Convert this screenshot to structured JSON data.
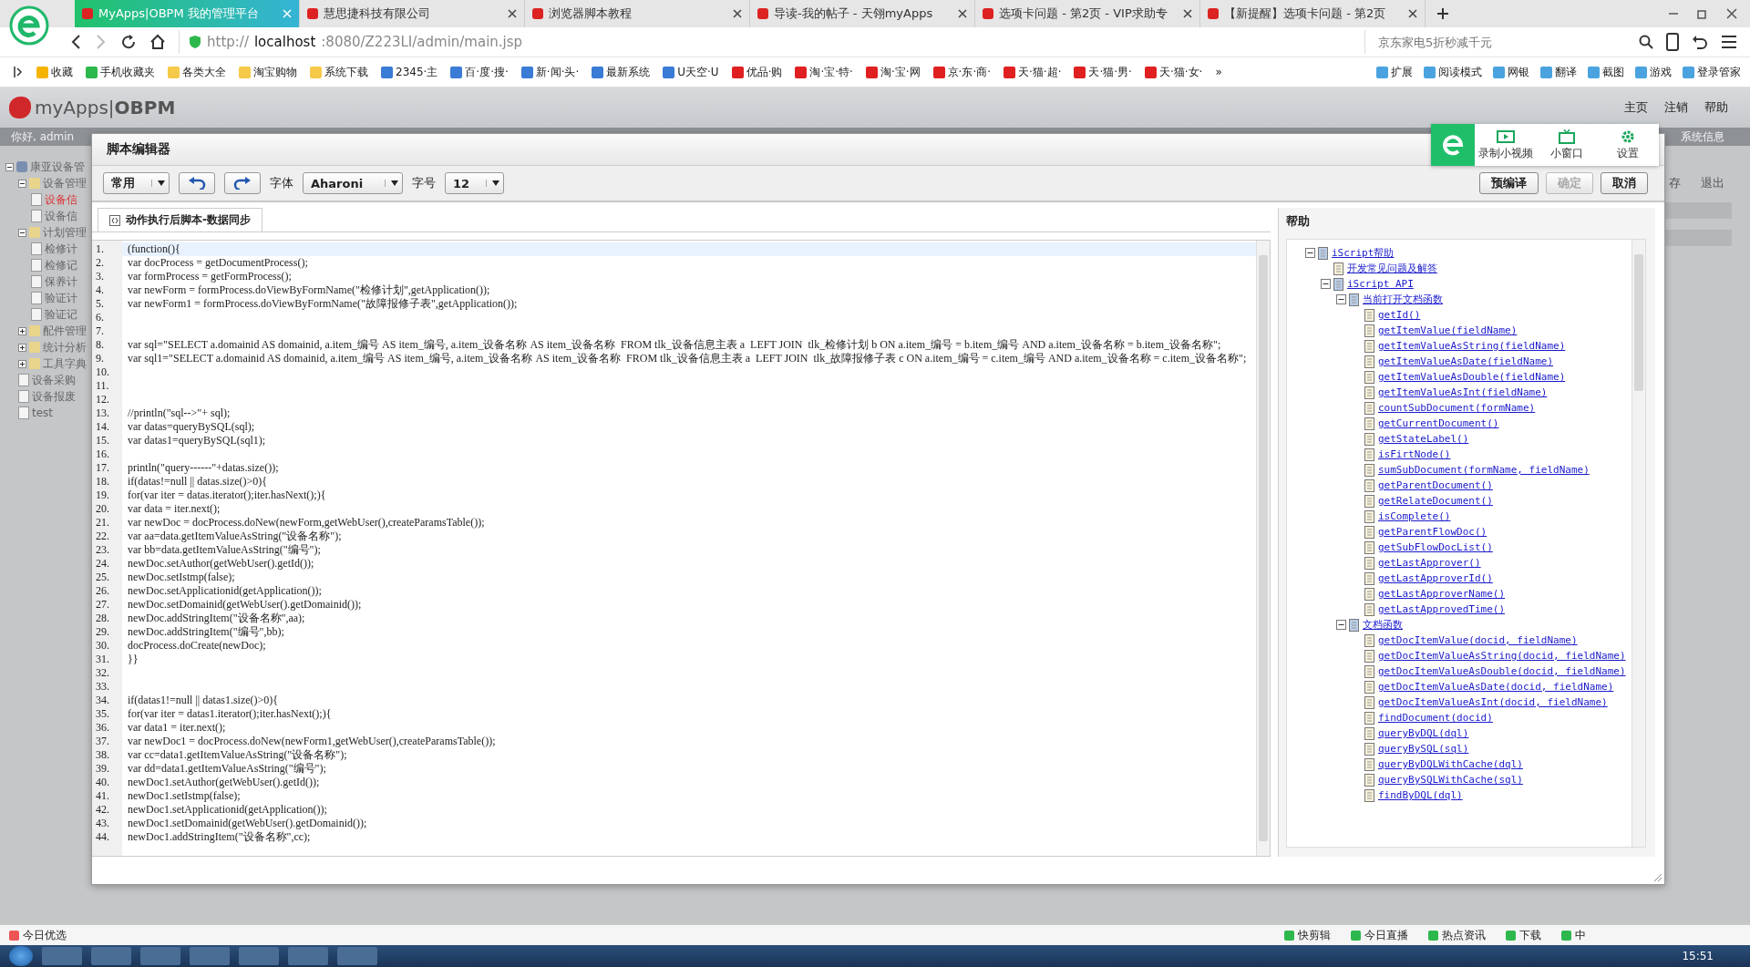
{
  "browser": {
    "tabs": [
      {
        "title": "MyApps|OBPM 我的管理平台",
        "selected": true
      },
      {
        "title": "慧思捷科技有限公司",
        "selected": false
      },
      {
        "title": "浏览器脚本教程",
        "selected": false
      },
      {
        "title": "导读-我的帖子 - 天翎myApps",
        "selected": false
      },
      {
        "title": "选项卡问题 - 第2页 - VIP求助专",
        "selected": false
      },
      {
        "title": "【新提醒】选项卡问题 - 第2页",
        "selected": false
      }
    ],
    "address": {
      "scheme": "http://",
      "host": "localhost",
      "rest": ":8080/Z223LI/admin/main.jsp"
    },
    "search": {
      "placeholder": "京东家电5折秒减千元"
    },
    "bookmarks": [
      {
        "label": "收藏",
        "kind": "star"
      },
      {
        "label": "手机收藏夹",
        "kind": "phone"
      },
      {
        "label": "各类大全",
        "kind": "folder"
      },
      {
        "label": "淘宝购物",
        "kind": "folder"
      },
      {
        "label": "系统下载",
        "kind": "folder"
      },
      {
        "label": "2345·主",
        "kind": "site"
      },
      {
        "label": "百·度·搜·",
        "kind": "site"
      },
      {
        "label": "新·闻·头·",
        "kind": "site"
      },
      {
        "label": "最新系统",
        "kind": "site"
      },
      {
        "label": "U天空·U",
        "kind": "site"
      },
      {
        "label": "优品·购",
        "kind": "shop"
      },
      {
        "label": "淘·宝·特·",
        "kind": "shop"
      },
      {
        "label": "淘·宝·网",
        "kind": "shop"
      },
      {
        "label": "京·东·商·",
        "kind": "shop"
      },
      {
        "label": "天·猫·超·",
        "kind": "shop"
      },
      {
        "label": "天·猫·男·",
        "kind": "shop"
      },
      {
        "label": "天·猫·女·",
        "kind": "shop"
      }
    ],
    "more": "»",
    "tools": [
      "扩展",
      "阅读模式",
      "网银",
      "翻译",
      "截图",
      "游戏",
      "登录管家"
    ]
  },
  "app": {
    "logo": "myApps|**OBPM**",
    "nav": [
      "主页",
      "注销",
      "帮助"
    ],
    "greeting": "你好, admin",
    "system_info": "系统信息",
    "actions": [
      "存",
      "退出"
    ]
  },
  "sidebar": {
    "tree": [
      {
        "label": "康亚设备管",
        "selected": false,
        "expanded": true,
        "children": [
          {
            "label": "设备管理",
            "selected": false,
            "expanded": true,
            "children": [
              {
                "label": "设备信",
                "selected": true
              },
              {
                "label": "设备信",
                "selected": false
              }
            ]
          },
          {
            "label": "计划管理",
            "selected": false,
            "expanded": true,
            "children": [
              {
                "label": "检修计",
                "selected": false
              },
              {
                "label": "检修记",
                "selected": false
              },
              {
                "label": "保养计",
                "selected": false
              },
              {
                "label": "验证计",
                "selected": false
              },
              {
                "label": "验证记",
                "selected": false
              }
            ]
          },
          {
            "label": "配件管理",
            "selected": false,
            "expanded": false
          },
          {
            "label": "统计分析",
            "selected": false,
            "expanded": false
          },
          {
            "label": "工具字典",
            "selected": false,
            "expanded": false
          },
          {
            "label": "设备采购",
            "selected": false
          },
          {
            "label": "设备报废",
            "selected": false
          },
          {
            "label": "test",
            "selected": false
          }
        ]
      }
    ]
  },
  "dialog": {
    "title": "脚本编辑器",
    "toolbar": {
      "category": "常用",
      "font_label": "字体",
      "font": "Aharoni",
      "size_label": "字号",
      "size": "12"
    },
    "buttons": [
      {
        "label": "预编译",
        "disabled": false
      },
      {
        "label": "确定",
        "disabled": true
      },
      {
        "label": "取消",
        "disabled": false
      }
    ],
    "tab": "动作执行后脚本-数据同步",
    "lines": [
      {
        "no": "1.",
        "text": "(function(){",
        "selected": true
      },
      {
        "no": "2.",
        "text": "var docProcess = getDocumentProcess();",
        "selected": false
      },
      {
        "no": "3.",
        "text": "var formProcess = getFormProcess();",
        "selected": false
      },
      {
        "no": "4.",
        "text": "var newForm = formProcess.doViewByFormName(\"检修计划\",getApplication());",
        "selected": false
      },
      {
        "no": "5.",
        "text": "var newForm1 = formProcess.doViewByFormName(\"故障报修子表\",getApplication());",
        "selected": false
      },
      {
        "no": "6.",
        "selected": false
      },
      {
        "no": "7.",
        "selected": false
      },
      {
        "no": "8.",
        "text": "var sql=\"SELECT a.domainid AS domainid, a.item_编号 AS item_编号, a.item_设备名称 AS item_设备名称  FROM tlk_设备信息主表 a  LEFT JOIN  tlk_检修计划 b ON a.item_编号 = b.item_编号 AND a.item_设备名称 = b.item_设备名称\";",
        "selected": false
      },
      {
        "no": "9.",
        "text": "var sql1=\"SELECT a.domainid AS domainid, a.item_编号 AS item_编号, a.item_设备名称 AS item_设备名称  FROM tlk_设备信息主表 a  LEFT JOIN  tlk_故障报修子表 c ON a.item_编号 = c.item_编号 AND a.item_设备名称 = c.item_设备名称\";",
        "selected": false
      },
      {
        "no": "10.",
        "selected": false
      },
      {
        "no": "11.",
        "selected": false
      },
      {
        "no": "12.",
        "selected": false
      },
      {
        "no": "13.",
        "text": "//println(\"sql-->\"+ sql);",
        "selected": false
      },
      {
        "no": "14.",
        "text": "var datas=queryBySQL(sql);",
        "selected": false
      },
      {
        "no": "15.",
        "text": "var datas1=queryBySQL(sql1);",
        "selected": false
      },
      {
        "no": "16.",
        "selected": false
      },
      {
        "no": "17.",
        "text": "println(\"query------\"+datas.size());",
        "selected": false
      },
      {
        "no": "18.",
        "text": "if(datas!=null || datas.size()>0){",
        "selected": false
      },
      {
        "no": "19.",
        "text": "for(var iter = datas.iterator();iter.hasNext();){",
        "selected": false
      },
      {
        "no": "20.",
        "text": "var data = iter.next();",
        "selected": false
      },
      {
        "no": "21.",
        "text": "var newDoc = docProcess.doNew(newForm,getWebUser(),createParamsTable());",
        "selected": false
      },
      {
        "no": "22.",
        "text": "var aa=data.getItemValueAsString(\"设备名称\");",
        "selected": false
      },
      {
        "no": "23.",
        "text": "var bb=data.getItemValueAsString(\"编号\");",
        "selected": false
      },
      {
        "no": "24.",
        "text": "newDoc.setAuthor(getWebUser().getId());",
        "selected": false
      },
      {
        "no": "25.",
        "text": "newDoc.setIstmp(false);",
        "selected": false
      },
      {
        "no": "26.",
        "text": "newDoc.setApplicationid(getApplication());",
        "selected": false
      },
      {
        "no": "27.",
        "text": "newDoc.setDomainid(getWebUser().getDomainid());",
        "selected": false
      },
      {
        "no": "28.",
        "text": "newDoc.addStringItem(\"设备名称\",aa);",
        "selected": false
      },
      {
        "no": "29.",
        "text": "newDoc.addStringItem(\"编号\",bb);",
        "selected": false
      },
      {
        "no": "30.",
        "text": "docProcess.doCreate(newDoc);",
        "selected": false
      },
      {
        "no": "31.",
        "text": "}}",
        "selected": false
      },
      {
        "no": "32.",
        "selected": false
      },
      {
        "no": "33.",
        "selected": false
      },
      {
        "no": "34.",
        "text": "if(datas1!=null || datas1.size()>0){",
        "selected": false
      },
      {
        "no": "35.",
        "text": "for(var iter = datas1.iterator();iter.hasNext();){",
        "selected": false
      },
      {
        "no": "36.",
        "text": "var data1 = iter.next();",
        "selected": false
      },
      {
        "no": "37.",
        "text": "var newDoc1 = docProcess.doNew(newForm1,getWebUser(),createParamsTable());",
        "selected": false
      },
      {
        "no": "38.",
        "text": "var cc=data1.getItemValueAsString(\"设备名称\");",
        "selected": false
      },
      {
        "no": "39.",
        "text": "var dd=data1.getItemValueAsString(\"编号\");",
        "selected": false
      },
      {
        "no": "40.",
        "text": "newDoc1.setAuthor(getWebUser().getId());",
        "selected": false
      },
      {
        "no": "41.",
        "text": "newDoc1.setIstmp(false);",
        "selected": false
      },
      {
        "no": "42.",
        "text": "newDoc1.setApplicationid(getApplication());",
        "selected": false
      },
      {
        "no": "43.",
        "text": "newDoc1.setDomainid(getWebUser().getDomainid());",
        "selected": false
      },
      {
        "no": "44.",
        "text": "newDoc1.addStringItem(\"设备名称\",cc);",
        "selected": false
      }
    ],
    "help": {
      "title": "帮助",
      "tree": [
        {
          "label": "iScript帮助",
          "expanded": true,
          "children": [
            {
              "label": "开发常见问题及解答"
            },
            {
              "label": "iScript API",
              "expanded": true,
              "children": [
                {
                  "label": "当前打开文档函数",
                  "expanded": true,
                  "children": [
                    {
                      "label": "getId()"
                    },
                    {
                      "label": "getItemValue(fieldName)"
                    },
                    {
                      "label": "getItemValueAsString(fieldName)"
                    },
                    {
                      "label": "getItemValueAsDate(fieldName)"
                    },
                    {
                      "label": "getItemValueAsDouble(fieldName)"
                    },
                    {
                      "label": "getItemValueAsInt(fieldName)"
                    },
                    {
                      "label": "countSubDocument(formName)"
                    },
                    {
                      "label": "getCurrentDocument()"
                    },
                    {
                      "label": "getStateLabel()"
                    },
                    {
                      "label": "isFirtNode()"
                    },
                    {
                      "label": "sumSubDocument(formName, fieldName)"
                    },
                    {
                      "label": "getParentDocument()"
                    },
                    {
                      "label": "getRelateDocument()"
                    },
                    {
                      "label": "isComplete()"
                    },
                    {
                      "label": "getParentFlowDoc()"
                    },
                    {
                      "label": "getSubFlowDocList()"
                    },
                    {
                      "label": "getLastApprover()"
                    },
                    {
                      "label": "getLastApproverId()"
                    },
                    {
                      "label": "getLastApproverName()"
                    },
                    {
                      "label": "getLastApprovedTime()"
                    }
                  ]
                },
                {
                  "label": "文档函数",
                  "expanded": true,
                  "children": [
                    {
                      "label": "getDocItemValue(docid, fieldName)"
                    },
                    {
                      "label": "getDocItemValueAsString(docid, fieldName)"
                    },
                    {
                      "label": "getDocItemValueAsDouble(docid, fieldName)"
                    },
                    {
                      "label": "getDocItemValueAsDate(docid, fieldName)"
                    },
                    {
                      "label": "getDocItemValueAsInt(docid, fieldName)"
                    },
                    {
                      "label": "findDocument(docid)"
                    },
                    {
                      "label": "queryByDQL(dql)"
                    },
                    {
                      "label": "queryBySQL(sql)"
                    },
                    {
                      "label": "queryByDQLWithCache(dql)"
                    },
                    {
                      "label": "queryBySQLWithCache(sql)"
                    },
                    {
                      "label": "findByDQL(dql)"
                    }
                  ]
                }
              ]
            }
          ]
        }
      ]
    }
  },
  "overlay": {
    "items": [
      {
        "label": "录制小视频",
        "kind": "video"
      },
      {
        "label": "小窗口",
        "kind": "tv"
      },
      {
        "label": "设置",
        "kind": "gear"
      }
    ]
  },
  "status_bar": {
    "left": "今日优选",
    "right": [
      "快剪辑",
      "今日直播",
      "热点资讯",
      "下载",
      "中"
    ]
  },
  "taskbar": {
    "time": "15:51"
  }
}
